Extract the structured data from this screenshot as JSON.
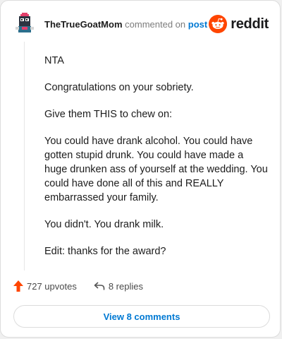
{
  "header": {
    "username": "TheTrueGoatMom",
    "action_text": "commented on",
    "post_link": "post",
    "brand": "reddit"
  },
  "comment": {
    "paragraphs": [
      "NTA",
      "Congratulations on your sobriety.",
      "Give them THIS to chew on:",
      "You could have drank alcohol. You could have gotten stupid drunk. You could have made a huge drunken ass of yourself at the wedding. You could have done all of this and REALLY embarrassed your family.",
      "You didn't. You drank milk.",
      "Edit: thanks for the award?"
    ]
  },
  "footer": {
    "upvotes": "727 upvotes",
    "replies": "8 replies",
    "view_comments": "View 8 comments"
  },
  "icons": {
    "avatar": "user-avatar",
    "brand": "reddit-logo-icon",
    "upvote": "upvote-arrow-icon",
    "reply": "reply-arrow-icon"
  },
  "colors": {
    "upvote": "#ff4500",
    "link": "#0079d3",
    "brand": "#ff4500"
  }
}
